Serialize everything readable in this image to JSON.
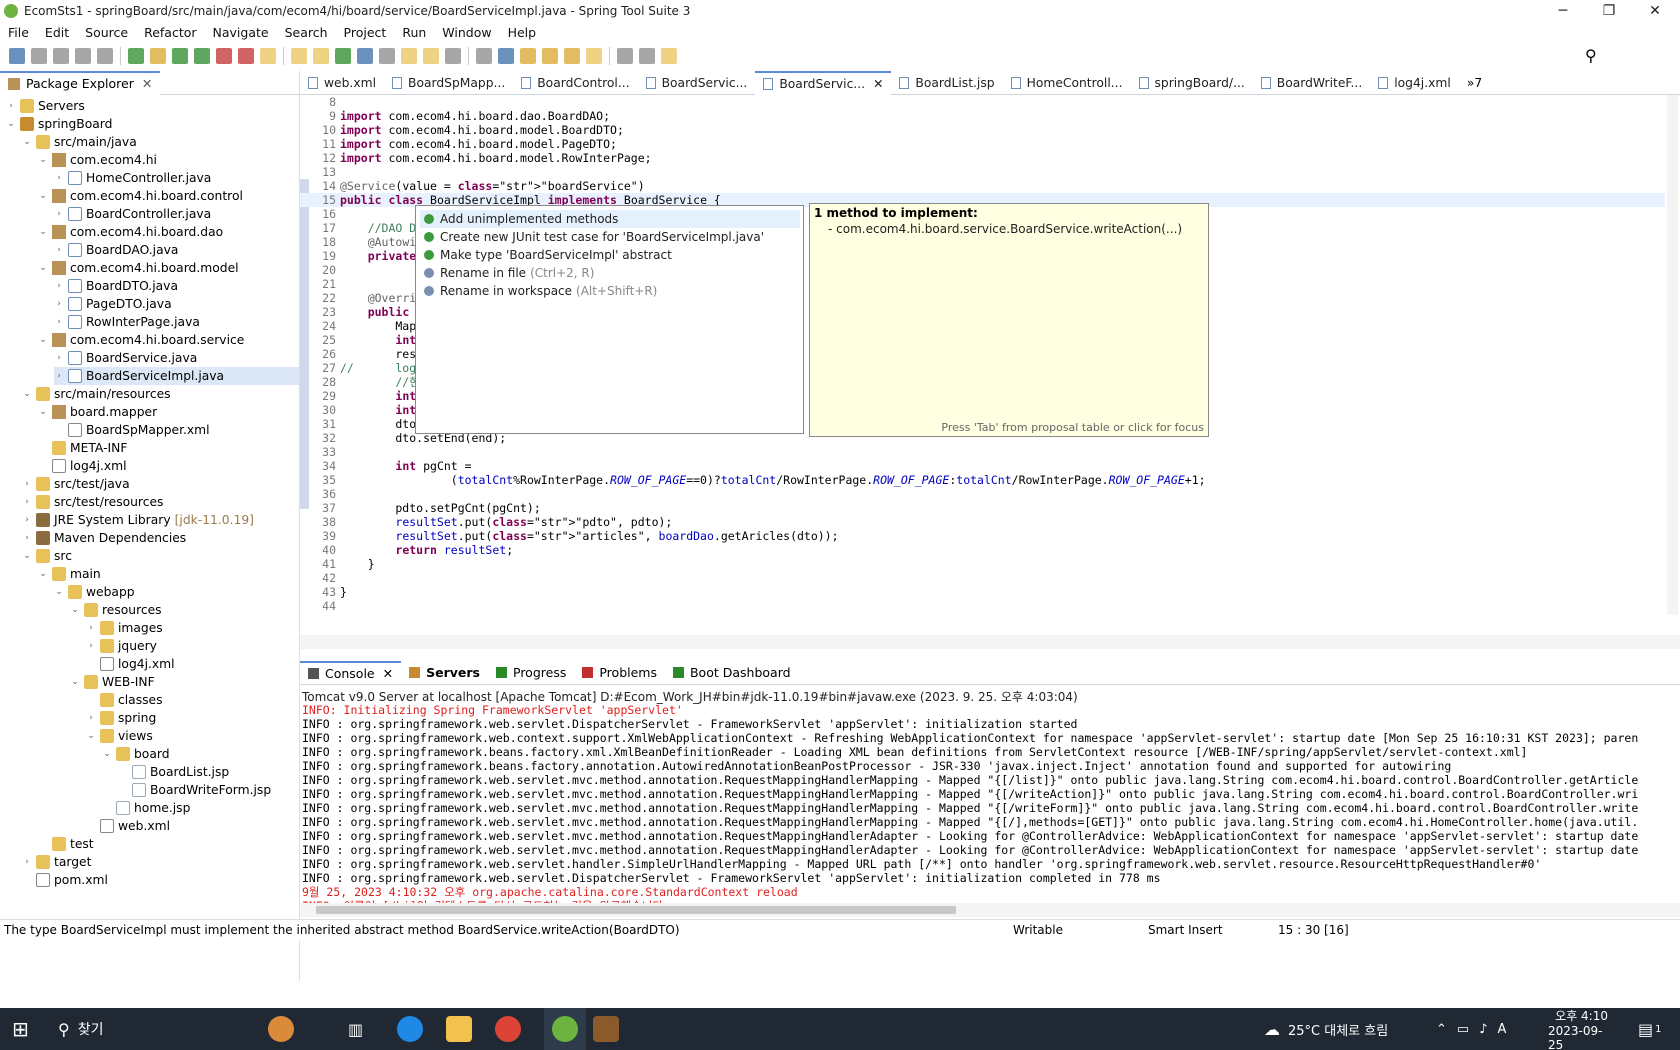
{
  "window": {
    "title": "EcomSts1 - springBoard/src/main/java/com/ecom4/hi/board/service/BoardServiceImpl.java - Spring Tool Suite 3",
    "minimize": "─",
    "maximize": "❐",
    "close": "✕"
  },
  "menu": [
    "File",
    "Edit",
    "Source",
    "Refactor",
    "Navigate",
    "Search",
    "Project",
    "Run",
    "Window",
    "Help"
  ],
  "package_explorer": {
    "title": "Package Explorer",
    "items": [
      {
        "label": "Servers",
        "indent": 0,
        "icon": "folder-icon",
        "tw": "›"
      },
      {
        "label": "springBoard",
        "indent": 0,
        "icon": "project-icon",
        "tw": "⌄"
      },
      {
        "label": "src/main/java",
        "indent": 1,
        "icon": "source-folder-icon",
        "tw": "⌄"
      },
      {
        "label": "com.ecom4.hi",
        "indent": 2,
        "icon": "package-icon",
        "tw": "⌄"
      },
      {
        "label": "HomeController.java",
        "indent": 3,
        "icon": "java-file-icon",
        "tw": "›"
      },
      {
        "label": "com.ecom4.hi.board.control",
        "indent": 2,
        "icon": "package-icon",
        "tw": "⌄"
      },
      {
        "label": "BoardController.java",
        "indent": 3,
        "icon": "java-file-icon",
        "tw": "›"
      },
      {
        "label": "com.ecom4.hi.board.dao",
        "indent": 2,
        "icon": "package-icon",
        "tw": "⌄"
      },
      {
        "label": "BoardDAO.java",
        "indent": 3,
        "icon": "java-file-icon",
        "tw": "›"
      },
      {
        "label": "com.ecom4.hi.board.model",
        "indent": 2,
        "icon": "package-icon",
        "tw": "⌄"
      },
      {
        "label": "BoardDTO.java",
        "indent": 3,
        "icon": "java-file-icon",
        "tw": "›"
      },
      {
        "label": "PageDTO.java",
        "indent": 3,
        "icon": "java-file-icon",
        "tw": "›"
      },
      {
        "label": "RowInterPage.java",
        "indent": 3,
        "icon": "java-file-icon",
        "tw": "›"
      },
      {
        "label": "com.ecom4.hi.board.service",
        "indent": 2,
        "icon": "package-icon",
        "tw": "⌄"
      },
      {
        "label": "BoardService.java",
        "indent": 3,
        "icon": "java-file-icon",
        "tw": "›"
      },
      {
        "label": "BoardServiceImpl.java",
        "indent": 3,
        "icon": "java-file-icon",
        "tw": "›",
        "selected": true
      },
      {
        "label": "src/main/resources",
        "indent": 1,
        "icon": "source-folder-icon",
        "tw": "⌄"
      },
      {
        "label": "board.mapper",
        "indent": 2,
        "icon": "package-icon",
        "tw": "⌄"
      },
      {
        "label": "BoardSpMapper.xml",
        "indent": 3,
        "icon": "xml-file-icon",
        "tw": ""
      },
      {
        "label": "META-INF",
        "indent": 2,
        "icon": "folder-icon",
        "tw": ""
      },
      {
        "label": "log4j.xml",
        "indent": 2,
        "icon": "xml-file-icon",
        "tw": ""
      },
      {
        "label": "src/test/java",
        "indent": 1,
        "icon": "source-folder-icon",
        "tw": "›"
      },
      {
        "label": "src/test/resources",
        "indent": 1,
        "icon": "source-folder-icon",
        "tw": "›"
      },
      {
        "label": "JRE System Library",
        "suffix": "[jdk-11.0.19]",
        "indent": 1,
        "icon": "library-icon",
        "tw": "›"
      },
      {
        "label": "Maven Dependencies",
        "indent": 1,
        "icon": "library-icon",
        "tw": "›"
      },
      {
        "label": "src",
        "indent": 1,
        "icon": "folder-icon",
        "tw": "⌄"
      },
      {
        "label": "main",
        "indent": 2,
        "icon": "folder-icon",
        "tw": "⌄"
      },
      {
        "label": "webapp",
        "indent": 3,
        "icon": "folder-icon",
        "tw": "⌄"
      },
      {
        "label": "resources",
        "indent": 4,
        "icon": "folder-icon",
        "tw": "⌄"
      },
      {
        "label": "images",
        "indent": 5,
        "icon": "folder-icon",
        "tw": "›"
      },
      {
        "label": "jquery",
        "indent": 5,
        "icon": "folder-icon",
        "tw": "›"
      },
      {
        "label": "log4j.xml",
        "indent": 5,
        "icon": "xml-file-icon",
        "tw": ""
      },
      {
        "label": "WEB-INF",
        "indent": 4,
        "icon": "folder-icon",
        "tw": "⌄"
      },
      {
        "label": "classes",
        "indent": 5,
        "icon": "folder-icon",
        "tw": ""
      },
      {
        "label": "spring",
        "indent": 5,
        "icon": "folder-icon",
        "tw": "›"
      },
      {
        "label": "views",
        "indent": 5,
        "icon": "folder-icon",
        "tw": "⌄"
      },
      {
        "label": "board",
        "indent": 6,
        "icon": "folder-icon",
        "tw": "⌄"
      },
      {
        "label": "BoardList.jsp",
        "indent": 7,
        "icon": "jsp-file-icon",
        "tw": ""
      },
      {
        "label": "BoardWriteForm.jsp",
        "indent": 7,
        "icon": "jsp-file-icon",
        "tw": ""
      },
      {
        "label": "home.jsp",
        "indent": 6,
        "icon": "jsp-file-icon",
        "tw": ""
      },
      {
        "label": "web.xml",
        "indent": 5,
        "icon": "xml-file-icon",
        "tw": ""
      },
      {
        "label": "test",
        "indent": 2,
        "icon": "folder-icon",
        "tw": ""
      },
      {
        "label": "target",
        "indent": 1,
        "icon": "folder-icon",
        "tw": "›"
      },
      {
        "label": "pom.xml",
        "indent": 1,
        "icon": "xml-file-icon",
        "tw": ""
      }
    ]
  },
  "editor_tabs": [
    "web.xml",
    "BoardSpMapp...",
    "BoardControl...",
    "BoardServic...",
    "BoardServic...",
    "BoardList.jsp",
    "HomeControll...",
    "springBoard/...",
    "BoardWriteF...",
    "log4j.xml"
  ],
  "editor_tabs_overflow": "»7",
  "code": [
    {
      "n": "8",
      "t": ""
    },
    {
      "n": "9",
      "t": "import com.ecom4.hi.board.dao.BoardDAO;"
    },
    {
      "n": "10",
      "t": "import com.ecom4.hi.board.model.BoardDTO;"
    },
    {
      "n": "11",
      "t": "import com.ecom4.hi.board.model.PageDTO;"
    },
    {
      "n": "12",
      "t": "import com.ecom4.hi.board.model.RowInterPage;"
    },
    {
      "n": "13",
      "t": ""
    },
    {
      "n": "14",
      "t": "@Service(value = \"boardService\")"
    },
    {
      "n": "15",
      "t": "public class BoardServiceImpl implements BoardService {"
    },
    {
      "n": "16",
      "t": ""
    },
    {
      "n": "17",
      "t": "    //DAO DI(D"
    },
    {
      "n": "18",
      "t": "    @Autowired"
    },
    {
      "n": "19",
      "t": "    private Bo"
    },
    {
      "n": "20",
      "t": ""
    },
    {
      "n": "21",
      "t": ""
    },
    {
      "n": "22",
      "t": "    @Override"
    },
    {
      "n": "23",
      "t": "    public Map"
    },
    {
      "n": "24",
      "t": "        Map<St"
    },
    {
      "n": "25",
      "t": "        int to"
    },
    {
      "n": "26",
      "t": "        result"
    },
    {
      "n": "27",
      "t": "//      logger"
    },
    {
      "n": "28",
      "t": "        //현재"
    },
    {
      "n": "29",
      "t": "        int st"
    },
    {
      "n": "30",
      "t": "        int en"
    },
    {
      "n": "31",
      "t": "        dto.se"
    },
    {
      "n": "32",
      "t": "        dto.setEnd(end);"
    },
    {
      "n": "33",
      "t": ""
    },
    {
      "n": "34",
      "t": "        int pgCnt ="
    },
    {
      "n": "35",
      "t": "                (totalCnt%RowInterPage.ROW_OF_PAGE==0)?totalCnt/RowInterPage.ROW_OF_PAGE:totalCnt/RowInterPage.ROW_OF_PAGE+1;"
    },
    {
      "n": "36",
      "t": ""
    },
    {
      "n": "37",
      "t": "        pdto.setPgCnt(pgCnt);"
    },
    {
      "n": "38",
      "t": "        resultSet.put(\"pdto\", pdto);"
    },
    {
      "n": "39",
      "t": "        resultSet.put(\"articles\", boardDao.getAricles(dto));"
    },
    {
      "n": "40",
      "t": "        return resultSet;"
    },
    {
      "n": "41",
      "t": "    }"
    },
    {
      "n": "42",
      "t": ""
    },
    {
      "n": "43",
      "t": "}"
    },
    {
      "n": "44",
      "t": ""
    }
  ],
  "quickfix": {
    "items": [
      {
        "label": "Add unimplemented methods",
        "hint": ""
      },
      {
        "label": "Create new JUnit test case for 'BoardServiceImpl.java'",
        "hint": ""
      },
      {
        "label": "Make type 'BoardServiceImpl' abstract",
        "hint": ""
      },
      {
        "label": "Rename in file",
        "hint": "(Ctrl+2, R)"
      },
      {
        "label": "Rename in workspace",
        "hint": "(Alt+Shift+R)"
      }
    ],
    "doc_title": "1 method to implement:",
    "doc_line": "- com.ecom4.hi.board.service.BoardService.writeAction(...)",
    "doc_footer": "Press 'Tab' from proposal table or click for focus"
  },
  "bottom_tabs": [
    "Console",
    "Servers",
    "Progress",
    "Problems",
    "Boot Dashboard"
  ],
  "console_desc": "Tomcat v9.0 Server at localhost [Apache Tomcat] D:#Ecom_Work_JH#bin#jdk-11.0.19#bin#javaw.exe  (2023. 9. 25. 오후 4:03:04)",
  "console": [
    {
      "t": "INFO: Initializing Spring FrameworkServlet 'appServlet'",
      "red": true
    },
    {
      "t": "INFO : org.springframework.web.servlet.DispatcherServlet - FrameworkServlet 'appServlet': initialization started",
      "red": false
    },
    {
      "t": "INFO : org.springframework.web.context.support.XmlWebApplicationContext - Refreshing WebApplicationContext for namespace 'appServlet-servlet': startup date [Mon Sep 25 16:10:31 KST 2023]; paren",
      "red": false
    },
    {
      "t": "INFO : org.springframework.beans.factory.xml.XmlBeanDefinitionReader - Loading XML bean definitions from ServletContext resource [/WEB-INF/spring/appServlet/servlet-context.xml]",
      "red": false
    },
    {
      "t": "INFO : org.springframework.beans.factory.annotation.AutowiredAnnotationBeanPostProcessor - JSR-330 'javax.inject.Inject' annotation found and supported for autowiring",
      "red": false
    },
    {
      "t": "INFO : org.springframework.web.servlet.mvc.method.annotation.RequestMappingHandlerMapping - Mapped \"{[/list]}\" onto public java.lang.String com.ecom4.hi.board.control.BoardController.getArticle",
      "red": false
    },
    {
      "t": "INFO : org.springframework.web.servlet.mvc.method.annotation.RequestMappingHandlerMapping - Mapped \"{[/writeAction]}\" onto public java.lang.String com.ecom4.hi.board.control.BoardController.wri",
      "red": false
    },
    {
      "t": "INFO : org.springframework.web.servlet.mvc.method.annotation.RequestMappingHandlerMapping - Mapped \"{[/writeForm]}\" onto public java.lang.String com.ecom4.hi.board.control.BoardController.write",
      "red": false
    },
    {
      "t": "INFO : org.springframework.web.servlet.mvc.method.annotation.RequestMappingHandlerMapping - Mapped \"{[/],methods=[GET]}\" onto public java.lang.String com.ecom4.hi.HomeController.home(java.util.",
      "red": false
    },
    {
      "t": "INFO : org.springframework.web.servlet.mvc.method.annotation.RequestMappingHandlerAdapter - Looking for @ControllerAdvice: WebApplicationContext for namespace 'appServlet-servlet': startup date",
      "red": false
    },
    {
      "t": "INFO : org.springframework.web.servlet.mvc.method.annotation.RequestMappingHandlerAdapter - Looking for @ControllerAdvice: WebApplicationContext for namespace 'appServlet-servlet': startup date",
      "red": false
    },
    {
      "t": "INFO : org.springframework.web.servlet.handler.SimpleUrlHandlerMapping - Mapped URL path [/**] onto handler 'org.springframework.web.servlet.resource.ResourceHttpRequestHandler#0'",
      "red": false
    },
    {
      "t": "INFO : org.springframework.web.servlet.DispatcherServlet - FrameworkServlet 'appServlet': initialization completed in 778 ms",
      "red": false
    },
    {
      "t": "9월 25, 2023 4:10:32 오후 org.apache.catalina.core.StandardContext reload",
      "red": true
    },
    {
      "t": "INFO: 이름이 [/hi]인 컨텍스트를 다시 로드하는 것을 완료했습니다.",
      "red": true
    }
  ],
  "status": {
    "message": "The type BoardServiceImpl must implement the inherited abstract method BoardService.writeAction(BoardDTO)",
    "writable": "Writable",
    "insert": "Smart Insert",
    "position": "15 : 30 [16]"
  },
  "taskbar": {
    "search": "찾기",
    "weather": "25°C 대체로 흐림",
    "time": "오후 4:10",
    "date": "2023-09-25",
    "ime": "A",
    "notif": "1"
  }
}
